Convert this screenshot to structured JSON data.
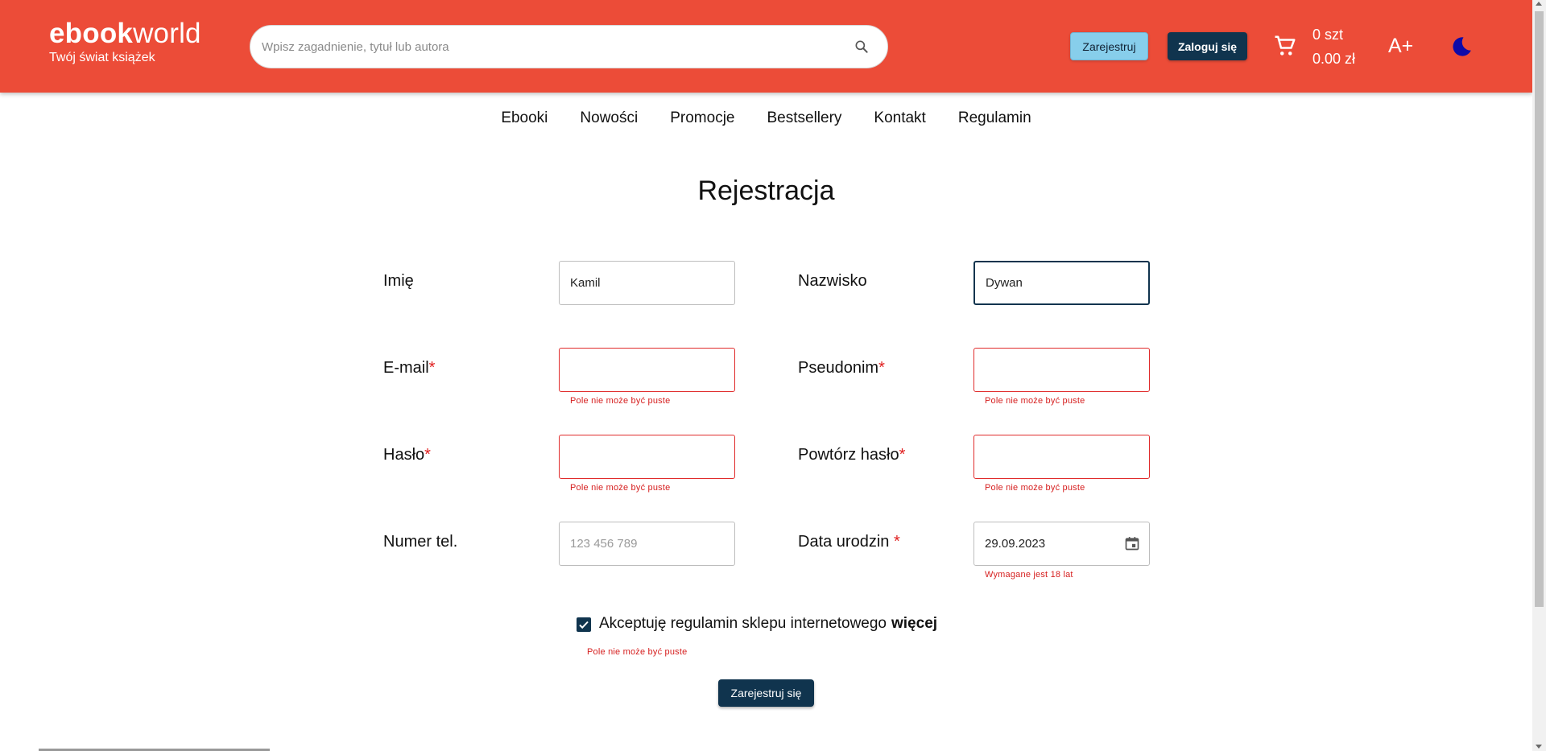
{
  "header": {
    "logo_bold": "ebook",
    "logo_light": "world",
    "logo_tagline": "Twój świat książek",
    "search_placeholder": "Wpisz zagadnienie, tytuł lub autora",
    "register_label": "Zarejestruj",
    "login_label": "Zaloguj się",
    "cart_count": "0 szt",
    "cart_total": "0.00 zł",
    "font_size_label": "A+",
    "colors": {
      "brand": "#ec4c38",
      "dark": "#10344e",
      "accent_light": "#87ceeb",
      "error": "#e02b2b"
    },
    "icons": [
      "search-icon",
      "cart-icon",
      "moon-icon"
    ]
  },
  "nav": {
    "items": [
      "Ebooki",
      "Nowości",
      "Promocje",
      "Bestsellery",
      "Kontakt",
      "Regulamin"
    ]
  },
  "form": {
    "title": "Rejestracja",
    "required_mark": "*",
    "first_name": {
      "label": "Imię",
      "value": "Kamil"
    },
    "last_name": {
      "label": "Nazwisko",
      "value": "Dywan"
    },
    "email": {
      "label": "E-mail",
      "value": "",
      "error": "Pole nie może być puste"
    },
    "nickname": {
      "label": "Pseudonim",
      "value": "",
      "error": "Pole nie może być puste"
    },
    "password": {
      "label": "Hasło",
      "value": "",
      "error": "Pole nie może być puste"
    },
    "password_repeat": {
      "label": "Powtórz hasło",
      "value": "",
      "error": "Pole nie może być puste"
    },
    "phone": {
      "label": "Numer tel.",
      "value": "",
      "placeholder": "123 456 789"
    },
    "birth_date": {
      "label": "Data urodzin ",
      "value": "29.09.2023",
      "error": "Wymagane jest 18 lat"
    },
    "terms": {
      "checked": true,
      "label": "Akceptuję regulamin sklepu internetowego",
      "more": "więcej",
      "error": "Pole nie może być puste"
    },
    "submit_label": "Zarejestruj się"
  }
}
